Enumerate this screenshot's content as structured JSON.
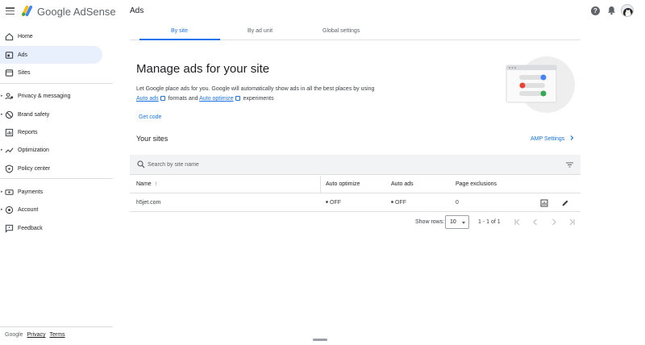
{
  "header": {
    "brand": "Google AdSense",
    "page_title": "Ads",
    "help_icon_label": "?"
  },
  "sidebar": {
    "items": [
      {
        "label": "Home",
        "icon": "home-icon"
      },
      {
        "label": "Ads",
        "icon": "ads-icon",
        "active": true
      },
      {
        "label": "Sites",
        "icon": "sites-icon"
      },
      {
        "label": "Privacy & messaging",
        "icon": "privacy-icon"
      },
      {
        "label": "Brand safety",
        "icon": "brand-safety-icon"
      },
      {
        "label": "Reports",
        "icon": "reports-icon"
      },
      {
        "label": "Optimization",
        "icon": "optimization-icon"
      },
      {
        "label": "Policy center",
        "icon": "policy-icon"
      },
      {
        "label": "Payments",
        "icon": "payments-icon"
      },
      {
        "label": "Account",
        "icon": "account-icon"
      },
      {
        "label": "Feedback",
        "icon": "feedback-icon"
      }
    ],
    "footer": {
      "google": "Google",
      "privacy": "Privacy",
      "terms": "Terms"
    }
  },
  "tabs": [
    {
      "label": "By site",
      "active": true
    },
    {
      "label": "By ad unit"
    },
    {
      "label": "Global settings"
    }
  ],
  "main": {
    "headline": "Manage ads for your site",
    "desc_part1": "Let Google place ads for you. Google will automatically show ads in all the best places by using",
    "auto_ads_link": "Auto ads",
    "desc_part2": "formats and",
    "auto_optimize_link": "Auto optimize",
    "desc_part3": "experiments",
    "get_code": "Get code",
    "your_sites": "Your sites",
    "amp_settings": "AMP Settings"
  },
  "search": {
    "placeholder": "Search by site name"
  },
  "table": {
    "headers": [
      "Name",
      "Auto optimize",
      "Auto ads",
      "Page exclusions"
    ],
    "rows": [
      {
        "name": "h5jet.com",
        "auto_optimize": "OFF",
        "auto_ads": "OFF",
        "page_exclusions": "0"
      }
    ]
  },
  "pagination": {
    "show_rows_label": "Show rows:",
    "rows_value": "10",
    "range": "1 - 1 of 1"
  },
  "colors": {
    "accent": "#1a73e8",
    "active_bg": "#e8f0fe"
  }
}
